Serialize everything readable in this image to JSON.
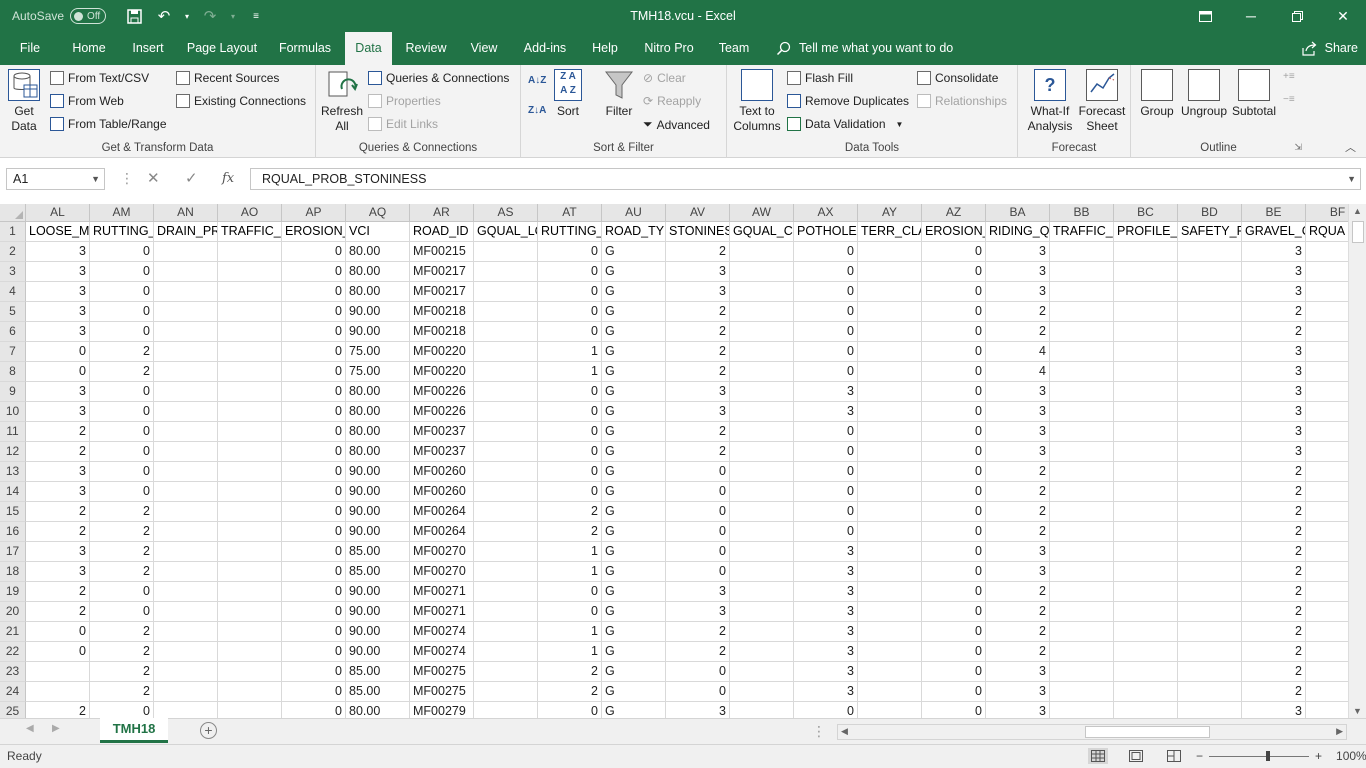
{
  "titlebar": {
    "autosave_label": "AutoSave",
    "autosave_state": "Off",
    "title": "TMH18.vcu  -  Excel"
  },
  "tabs": [
    "File",
    "Home",
    "Insert",
    "Page Layout",
    "Formulas",
    "Data",
    "Review",
    "View",
    "Add-ins",
    "Help",
    "Nitro Pro",
    "Team"
  ],
  "active_tab": "Data",
  "tellme": "Tell me what you want to do",
  "share": "Share",
  "ribbon": {
    "get_transform": {
      "label": "Get & Transform Data",
      "get_data": "Get",
      "get_data2": "Data",
      "from_text": "From Text/CSV",
      "from_web": "From Web",
      "from_table": "From Table/Range",
      "recent_sources": "Recent Sources",
      "existing_connections": "Existing Connections"
    },
    "queries": {
      "label": "Queries & Connections",
      "refresh": "Refresh",
      "refresh2": "All",
      "queries_connections": "Queries & Connections",
      "properties": "Properties",
      "edit_links": "Edit Links"
    },
    "sort_filter": {
      "label": "Sort & Filter",
      "sort": "Sort",
      "filter": "Filter",
      "clear": "Clear",
      "reapply": "Reapply",
      "advanced": "Advanced"
    },
    "data_tools": {
      "label": "Data Tools",
      "text_to_columns": "Text to",
      "text_to_columns2": "Columns",
      "flash_fill": "Flash Fill",
      "remove_duplicates": "Remove Duplicates",
      "data_validation": "Data Validation",
      "consolidate": "Consolidate",
      "relationships": "Relationships"
    },
    "forecast": {
      "label": "Forecast",
      "what_if": "What-If",
      "what_if2": "Analysis",
      "forecast_sheet": "Forecast",
      "forecast_sheet2": "Sheet"
    },
    "outline": {
      "label": "Outline",
      "group": "Group",
      "ungroup": "Ungroup",
      "subtotal": "Subtotal"
    }
  },
  "formula_bar": {
    "name_box": "A1",
    "fx": "fx",
    "content": "RQUAL_PROB_STONINESS"
  },
  "columns": [
    "AL",
    "AM",
    "AN",
    "AO",
    "AP",
    "AQ",
    "AR",
    "AS",
    "AT",
    "AU",
    "AV",
    "AW",
    "AX",
    "AY",
    "AZ",
    "BA",
    "BB",
    "BC",
    "BD",
    "BE",
    "BF"
  ],
  "row_numbers": [
    "1",
    "2",
    "3",
    "4",
    "5",
    "6",
    "7",
    "8",
    "9",
    "10",
    "11",
    "12",
    "13",
    "14",
    "15",
    "16",
    "17",
    "18",
    "19",
    "20",
    "21",
    "22",
    "23",
    "24",
    "25"
  ],
  "rows": [
    [
      "LOOSE_M.",
      "RUTTING_",
      "DRAIN_PR",
      "TRAFFIC_F",
      "EROSION_",
      "VCI",
      "ROAD_ID",
      "GQUAL_LC",
      "RUTTING_",
      "ROAD_TYF",
      "STONINES",
      "GQUAL_CI",
      "POTHOLES",
      "TERR_CLA",
      "EROSION_",
      "RIDING_Q",
      "TRAFFIC_F",
      "PROFILE_F",
      "SAFETY_PI",
      "GRAVEL_C",
      "RQUA"
    ],
    [
      "3",
      "0",
      "",
      "",
      "0",
      "80.00",
      "MF00215",
      "",
      "0",
      "G",
      "2",
      "",
      "0",
      "",
      "0",
      "3",
      "",
      "",
      "",
      "3",
      ""
    ],
    [
      "3",
      "0",
      "",
      "",
      "0",
      "80.00",
      "MF00217",
      "",
      "0",
      "G",
      "3",
      "",
      "0",
      "",
      "0",
      "3",
      "",
      "",
      "",
      "3",
      ""
    ],
    [
      "3",
      "0",
      "",
      "",
      "0",
      "80.00",
      "MF00217",
      "",
      "0",
      "G",
      "3",
      "",
      "0",
      "",
      "0",
      "3",
      "",
      "",
      "",
      "3",
      ""
    ],
    [
      "3",
      "0",
      "",
      "",
      "0",
      "90.00",
      "MF00218",
      "",
      "0",
      "G",
      "2",
      "",
      "0",
      "",
      "0",
      "2",
      "",
      "",
      "",
      "2",
      ""
    ],
    [
      "3",
      "0",
      "",
      "",
      "0",
      "90.00",
      "MF00218",
      "",
      "0",
      "G",
      "2",
      "",
      "0",
      "",
      "0",
      "2",
      "",
      "",
      "",
      "2",
      ""
    ],
    [
      "0",
      "2",
      "",
      "",
      "0",
      "75.00",
      "MF00220",
      "",
      "1",
      "G",
      "2",
      "",
      "0",
      "",
      "0",
      "4",
      "",
      "",
      "",
      "3",
      ""
    ],
    [
      "0",
      "2",
      "",
      "",
      "0",
      "75.00",
      "MF00220",
      "",
      "1",
      "G",
      "2",
      "",
      "0",
      "",
      "0",
      "4",
      "",
      "",
      "",
      "3",
      ""
    ],
    [
      "3",
      "0",
      "",
      "",
      "0",
      "80.00",
      "MF00226",
      "",
      "0",
      "G",
      "3",
      "",
      "3",
      "",
      "0",
      "3",
      "",
      "",
      "",
      "3",
      ""
    ],
    [
      "3",
      "0",
      "",
      "",
      "0",
      "80.00",
      "MF00226",
      "",
      "0",
      "G",
      "3",
      "",
      "3",
      "",
      "0",
      "3",
      "",
      "",
      "",
      "3",
      ""
    ],
    [
      "2",
      "0",
      "",
      "",
      "0",
      "80.00",
      "MF00237",
      "",
      "0",
      "G",
      "2",
      "",
      "0",
      "",
      "0",
      "3",
      "",
      "",
      "",
      "3",
      ""
    ],
    [
      "2",
      "0",
      "",
      "",
      "0",
      "80.00",
      "MF00237",
      "",
      "0",
      "G",
      "2",
      "",
      "0",
      "",
      "0",
      "3",
      "",
      "",
      "",
      "3",
      ""
    ],
    [
      "3",
      "0",
      "",
      "",
      "0",
      "90.00",
      "MF00260",
      "",
      "0",
      "G",
      "0",
      "",
      "0",
      "",
      "0",
      "2",
      "",
      "",
      "",
      "2",
      ""
    ],
    [
      "3",
      "0",
      "",
      "",
      "0",
      "90.00",
      "MF00260",
      "",
      "0",
      "G",
      "0",
      "",
      "0",
      "",
      "0",
      "2",
      "",
      "",
      "",
      "2",
      ""
    ],
    [
      "2",
      "2",
      "",
      "",
      "0",
      "90.00",
      "MF00264",
      "",
      "2",
      "G",
      "0",
      "",
      "0",
      "",
      "0",
      "2",
      "",
      "",
      "",
      "2",
      ""
    ],
    [
      "2",
      "2",
      "",
      "",
      "0",
      "90.00",
      "MF00264",
      "",
      "2",
      "G",
      "0",
      "",
      "0",
      "",
      "0",
      "2",
      "",
      "",
      "",
      "2",
      ""
    ],
    [
      "3",
      "2",
      "",
      "",
      "0",
      "85.00",
      "MF00270",
      "",
      "1",
      "G",
      "0",
      "",
      "3",
      "",
      "0",
      "3",
      "",
      "",
      "",
      "2",
      ""
    ],
    [
      "3",
      "2",
      "",
      "",
      "0",
      "85.00",
      "MF00270",
      "",
      "1",
      "G",
      "0",
      "",
      "3",
      "",
      "0",
      "3",
      "",
      "",
      "",
      "2",
      ""
    ],
    [
      "2",
      "0",
      "",
      "",
      "0",
      "90.00",
      "MF00271",
      "",
      "0",
      "G",
      "3",
      "",
      "3",
      "",
      "0",
      "2",
      "",
      "",
      "",
      "2",
      ""
    ],
    [
      "2",
      "0",
      "",
      "",
      "0",
      "90.00",
      "MF00271",
      "",
      "0",
      "G",
      "3",
      "",
      "3",
      "",
      "0",
      "2",
      "",
      "",
      "",
      "2",
      ""
    ],
    [
      "0",
      "2",
      "",
      "",
      "0",
      "90.00",
      "MF00274",
      "",
      "1",
      "G",
      "2",
      "",
      "3",
      "",
      "0",
      "2",
      "",
      "",
      "",
      "2",
      ""
    ],
    [
      "0",
      "2",
      "",
      "",
      "0",
      "90.00",
      "MF00274",
      "",
      "1",
      "G",
      "2",
      "",
      "3",
      "",
      "0",
      "2",
      "",
      "",
      "",
      "2",
      ""
    ],
    [
      "",
      "2",
      "",
      "",
      "0",
      "85.00",
      "MF00275",
      "",
      "2",
      "G",
      "0",
      "",
      "3",
      "",
      "0",
      "3",
      "",
      "",
      "",
      "2",
      ""
    ],
    [
      "",
      "2",
      "",
      "",
      "0",
      "85.00",
      "MF00275",
      "",
      "2",
      "G",
      "0",
      "",
      "3",
      "",
      "0",
      "3",
      "",
      "",
      "",
      "2",
      ""
    ],
    [
      "2",
      "0",
      "",
      "",
      "0",
      "80.00",
      "MF00279",
      "",
      "0",
      "G",
      "3",
      "",
      "0",
      "",
      "0",
      "3",
      "",
      "",
      "",
      "3",
      ""
    ]
  ],
  "sheet_tab": "TMH18",
  "status": {
    "ready": "Ready",
    "zoom": "100%"
  },
  "colors": {
    "accent": "#217346",
    "ribbon_bg": "#f3f3f3",
    "header_bg": "#e6e6e6"
  }
}
